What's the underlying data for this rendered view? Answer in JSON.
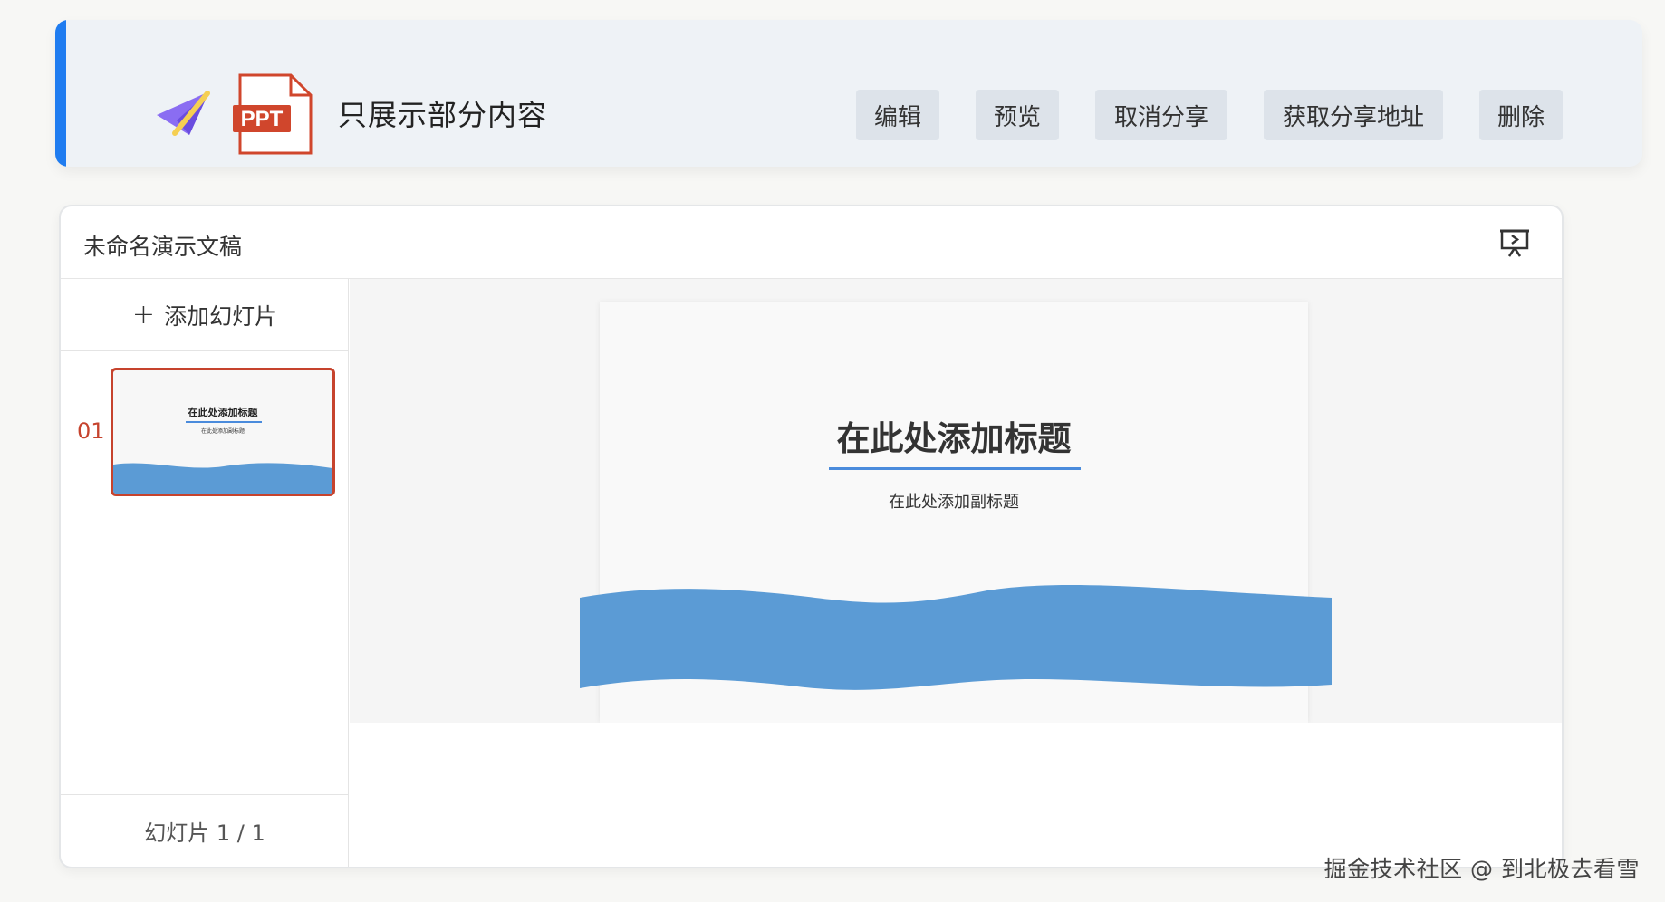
{
  "header": {
    "title": "只展示部分内容",
    "ppt_badge": "PPT",
    "buttons": {
      "edit": "编辑",
      "preview": "预览",
      "cancel_share": "取消分享",
      "get_share_link": "获取分享地址",
      "delete": "删除"
    },
    "icons": [
      "paper-plane-icon",
      "ppt-file-icon"
    ]
  },
  "editor": {
    "presentation_title": "未命名演示文稿",
    "add_slide_label": "添加幻灯片",
    "add_slide_icon": "+",
    "present_icon": "presentation-play-icon",
    "slides": [
      {
        "number": "01",
        "title": "在此处添加标题",
        "subtitle": "在此处添加副标题"
      }
    ],
    "slide_counter": "幻灯片 1 / 1",
    "current_slide": {
      "title": "在此处添加标题",
      "subtitle": "在此处添加副标题"
    }
  },
  "colors": {
    "accent_blue": "#1f7cf0",
    "selection_red": "#c6432d",
    "wave_blue": "#5b9bd5",
    "ppt_red": "#d0462c"
  },
  "watermark": "掘金技术社区 @ 到北极去看雪"
}
